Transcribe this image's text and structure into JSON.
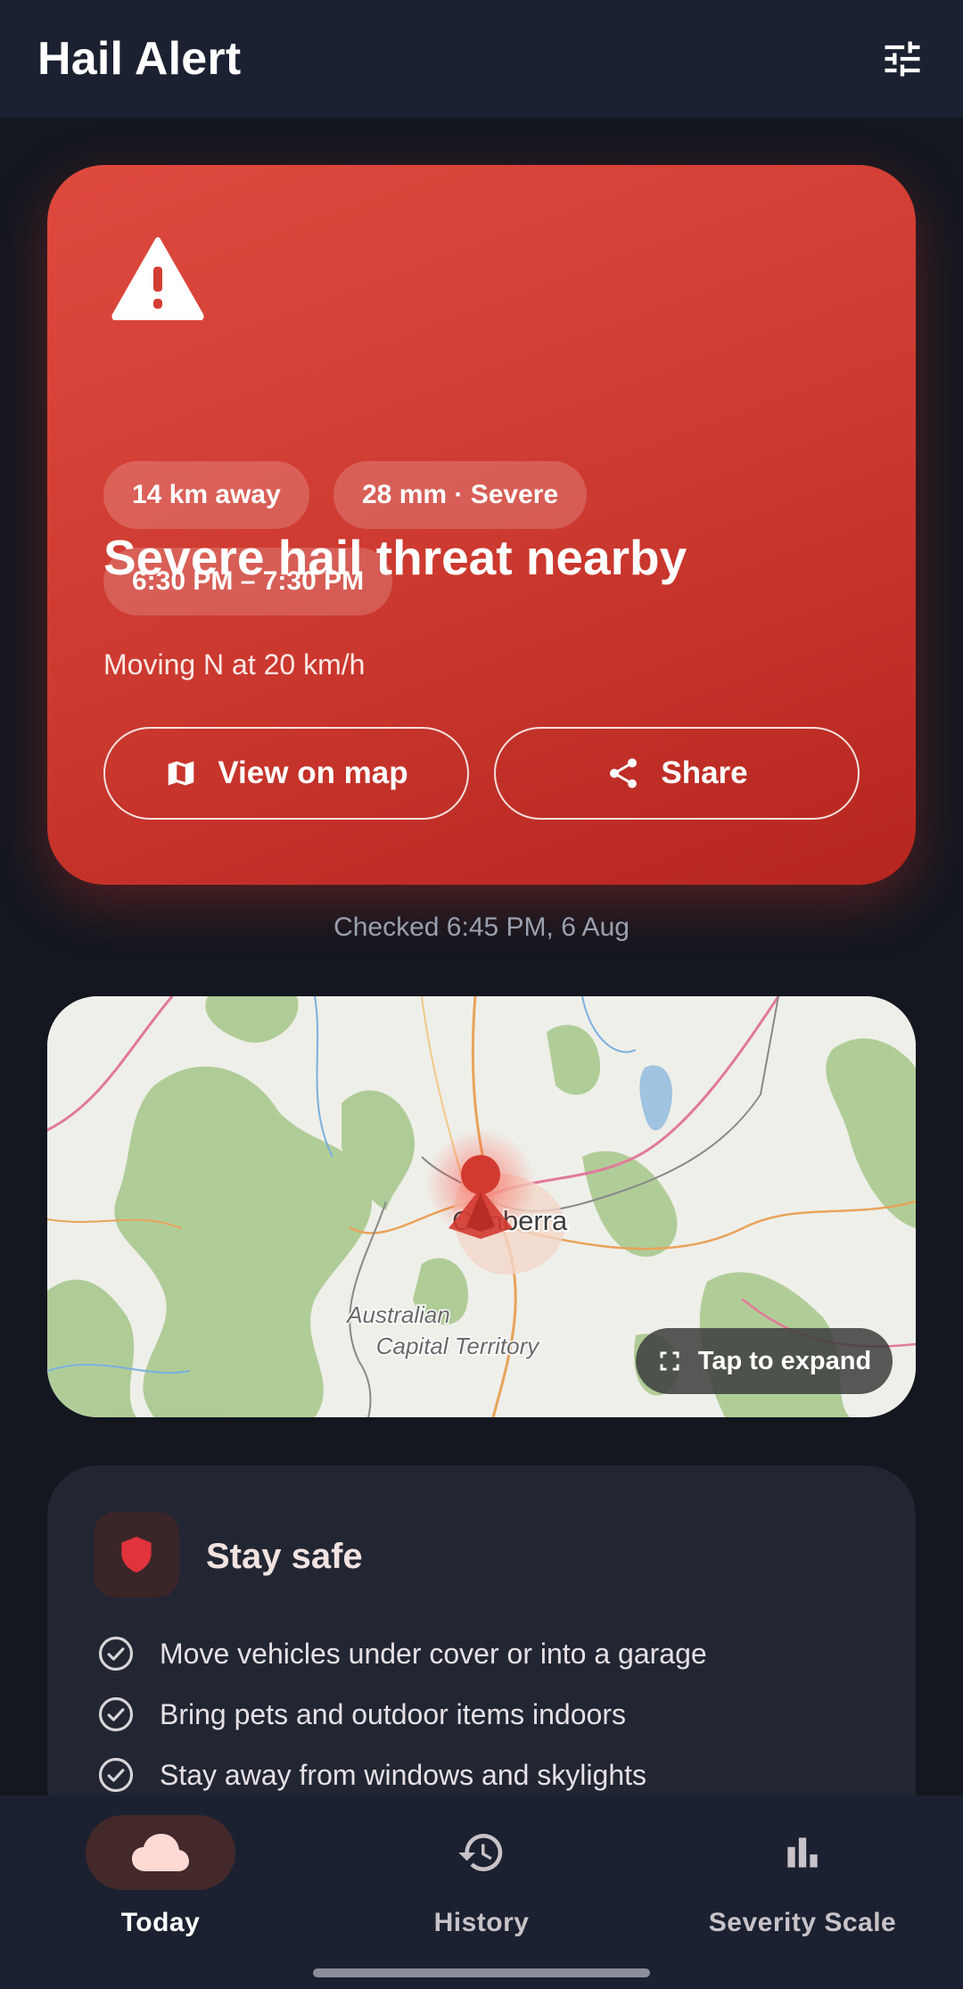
{
  "app": {
    "title": "Hail Alert"
  },
  "alert": {
    "title": "Severe hail threat nearby",
    "chips": [
      "14 km away",
      "28 mm · Severe",
      "6:30 PM – 7:30 PM"
    ],
    "movement": "Moving N at 20 km/h",
    "view_map_label": "View on map",
    "share_label": "Share",
    "accent_color": "#cd3a30"
  },
  "checked_text": "Checked 6:45 PM, 6 Aug",
  "map": {
    "place_label": "Canberra",
    "region_label_1": "Australian",
    "region_label_2": "Capital Territory",
    "expand_label": "Tap to expand"
  },
  "safety": {
    "title": "Stay safe",
    "tips": [
      "Move vehicles under cover or into a garage",
      "Bring pets and outdoor items indoors",
      "Stay away from windows and skylights"
    ]
  },
  "nav": {
    "items": [
      {
        "label": "Today",
        "icon": "cloud-icon",
        "active": true
      },
      {
        "label": "History",
        "icon": "history-icon",
        "active": false
      },
      {
        "label": "Severity Scale",
        "icon": "bar-chart-icon",
        "active": false
      }
    ]
  }
}
